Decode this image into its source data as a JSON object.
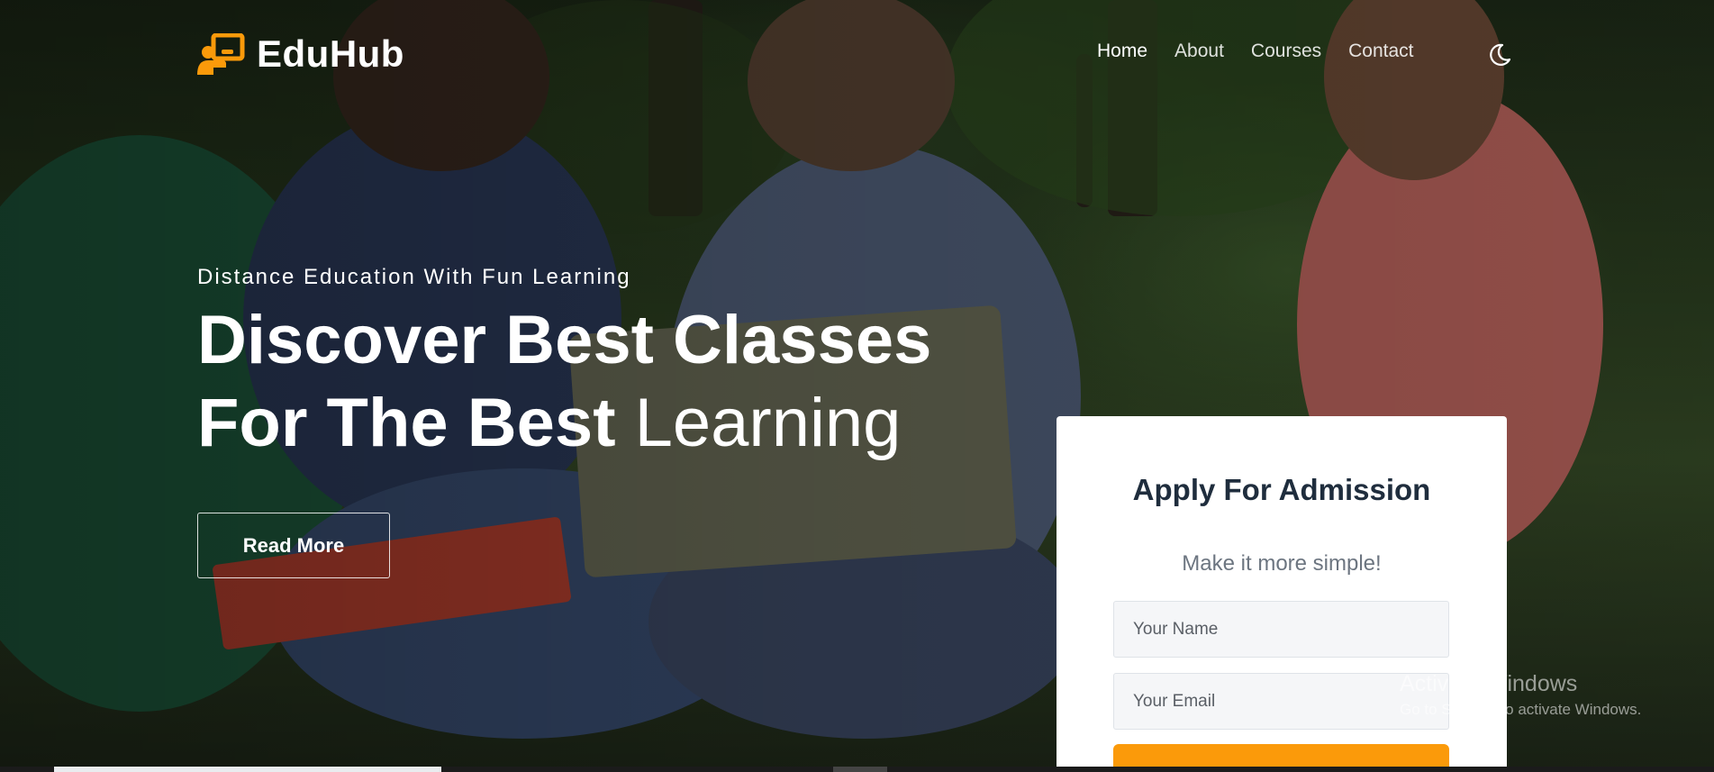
{
  "brand": {
    "name": "EduHub",
    "accent": "#FB9A0A"
  },
  "nav": {
    "items": [
      {
        "label": "Home",
        "active": true
      },
      {
        "label": "About",
        "active": false
      },
      {
        "label": "Courses",
        "active": false
      },
      {
        "label": "Contact",
        "active": false
      }
    ],
    "theme_icon": "moon-icon"
  },
  "hero": {
    "tagline": "Distance Education With Fun Learning",
    "headline_bold_line1": "Discover Best Classes",
    "headline_bold_line2": "For The Best",
    "headline_light": "Learning",
    "button_label": "Read More"
  },
  "admission": {
    "title": "Apply For Admission",
    "subtitle": "Make it more simple!",
    "name_placeholder": "Your Name",
    "email_placeholder": "Your Email"
  },
  "watermark": {
    "title": "Activate Windows",
    "subtitle": "Go to Settings to activate Windows."
  }
}
